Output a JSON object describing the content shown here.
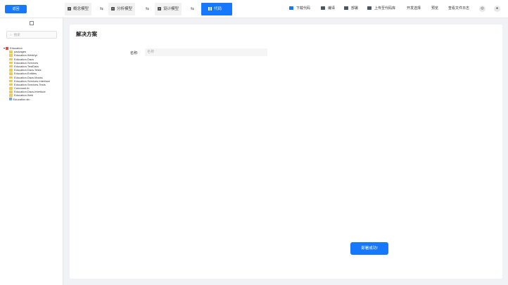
{
  "topbar": {
    "back_label": "返回",
    "tabs": [
      {
        "label": "概念模型",
        "active": false
      },
      {
        "label": "分析模型",
        "active": false
      },
      {
        "label": "设计模型",
        "active": false
      },
      {
        "label": "代码",
        "active": true
      }
    ],
    "swap_icon": "swap-arrows-icon",
    "tools": [
      {
        "label": "下载代码",
        "icon": "folder-icon"
      },
      {
        "label": "编译",
        "icon": "folder-icon"
      },
      {
        "label": "部署",
        "icon": "folder-icon"
      },
      {
        "label": "上传至代码库",
        "icon": "folder-icon"
      },
      {
        "label": "开发选择",
        "icon": ""
      },
      {
        "label": "预览",
        "icon": ""
      },
      {
        "label": "查看文件日志",
        "icon": ""
      }
    ],
    "circle_buttons": [
      {
        "icon": "help-circle-icon",
        "glyph": "◎"
      },
      {
        "icon": "user-icon",
        "glyph": "👤"
      }
    ],
    "accent_color": "#1677ff"
  },
  "sidebar": {
    "search_placeholder": "搜索",
    "tree": [
      {
        "label": "Education",
        "type": "root",
        "depth": 0
      },
      {
        "label": "packages",
        "type": "folder",
        "depth": 1
      },
      {
        "label": "Education.WebApi",
        "type": "folder",
        "depth": 1
      },
      {
        "label": "Education.Dacs",
        "type": "folder",
        "depth": 1
      },
      {
        "label": "Education.Services",
        "type": "folder",
        "depth": 1
      },
      {
        "label": "Education.TestData",
        "type": "folder",
        "depth": 1
      },
      {
        "label": "Education.Dacs.Tests",
        "type": "folder",
        "depth": 1
      },
      {
        "label": "Education.Entities",
        "type": "folder",
        "depth": 1
      },
      {
        "label": "Education.Dacs.Mocks",
        "type": "folder",
        "depth": 1
      },
      {
        "label": "Education.Services.Interface",
        "type": "folder",
        "depth": 1
      },
      {
        "label": "Education.Services.Tests",
        "type": "folder",
        "depth": 1
      },
      {
        "label": "CommonLib",
        "type": "folder",
        "depth": 1
      },
      {
        "label": "Education.Dacs.Interface",
        "type": "folder",
        "depth": 1
      },
      {
        "label": "Education.Web",
        "type": "folder",
        "depth": 1
      },
      {
        "label": "Education.sln",
        "type": "file",
        "depth": 1
      }
    ]
  },
  "main": {
    "title": "解决方案",
    "name_label": "名称:",
    "name_placeholder": "名称",
    "deploy_status": "部署成功!"
  }
}
